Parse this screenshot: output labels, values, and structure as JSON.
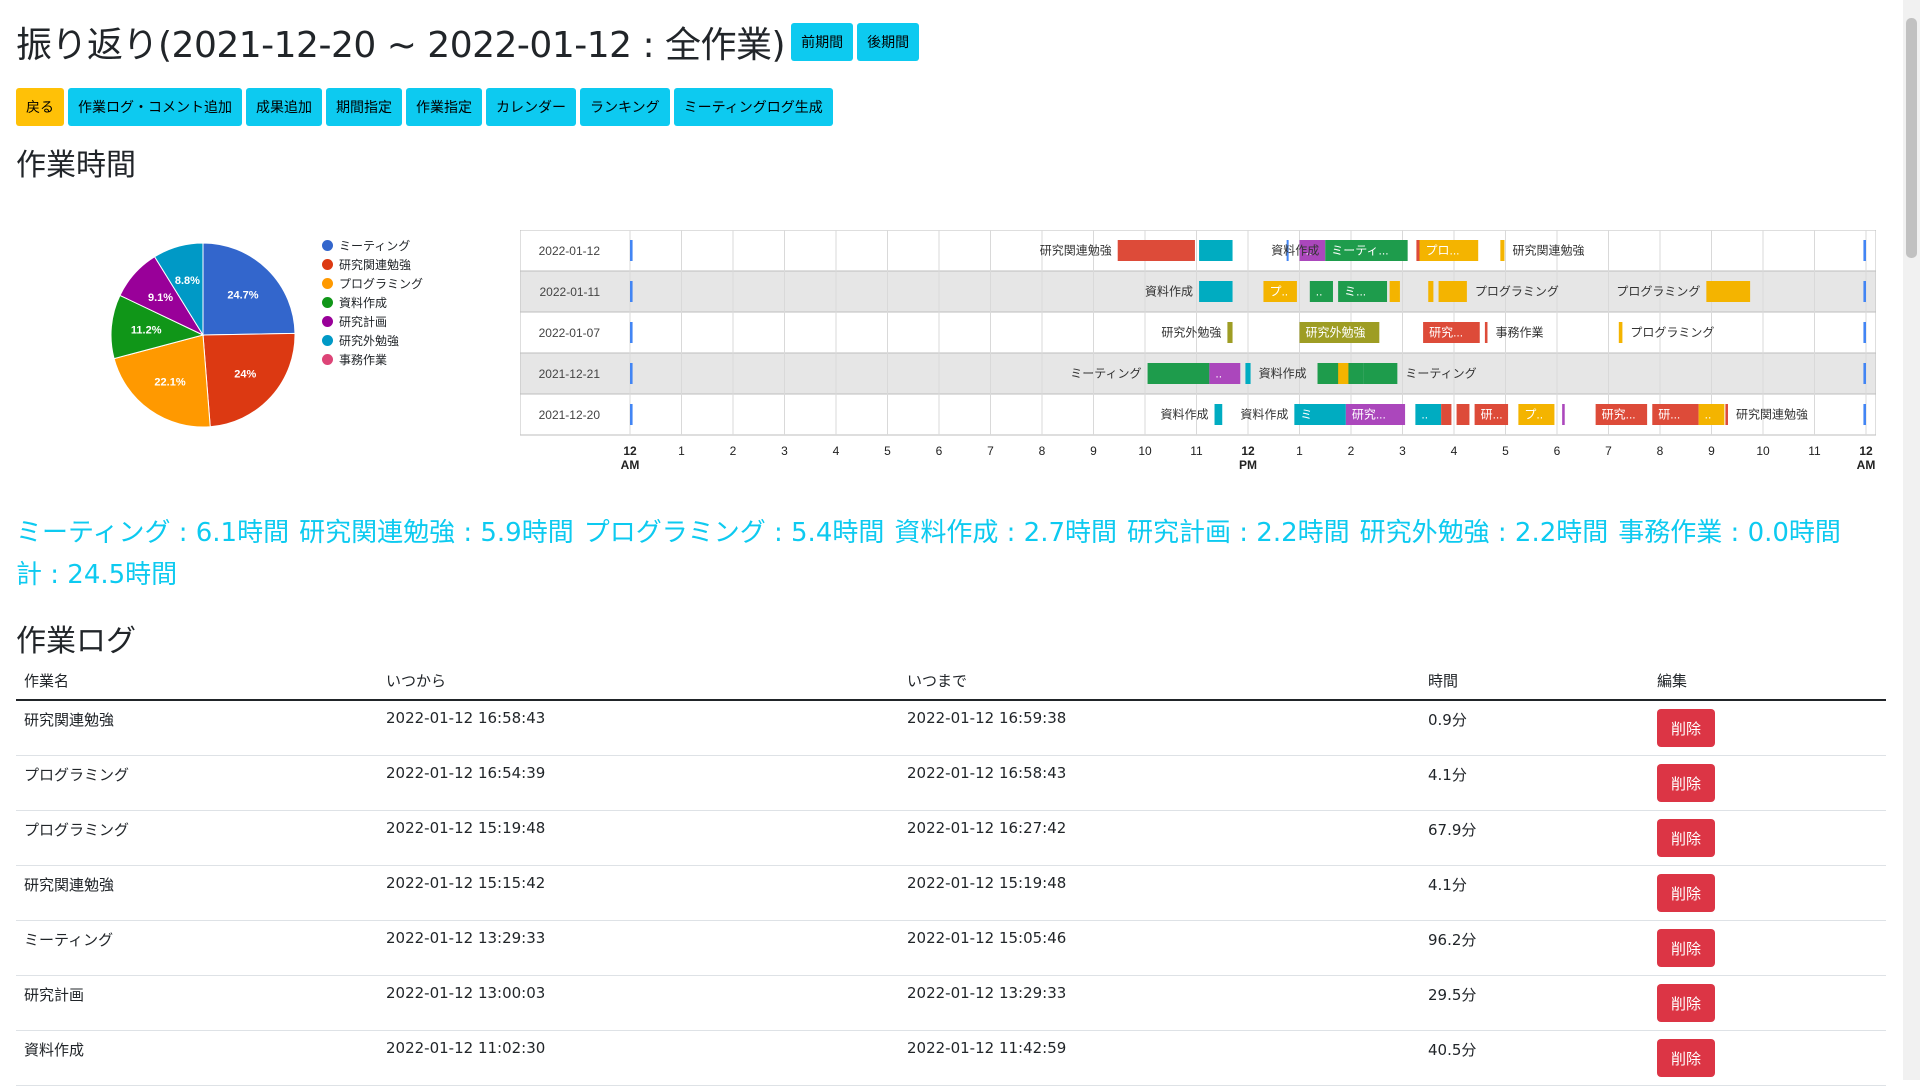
{
  "header": {
    "title": "振り返り(2021-12-20 ~ 2022-01-12 : 全作業)",
    "prev_label": "前期間",
    "next_label": "後期間"
  },
  "toolbar": [
    {
      "label": "戻る",
      "style": "warning"
    },
    {
      "label": "作業ログ・コメント追加",
      "style": "info"
    },
    {
      "label": "成果追加",
      "style": "info"
    },
    {
      "label": "期間指定",
      "style": "info"
    },
    {
      "label": "作業指定",
      "style": "info"
    },
    {
      "label": "カレンダー",
      "style": "info"
    },
    {
      "label": "ランキング",
      "style": "info"
    },
    {
      "label": "ミーティングログ生成",
      "style": "info"
    }
  ],
  "work_time": {
    "heading": "作業時間"
  },
  "colors": {
    "ミーティング": "#3366cc",
    "研究関連勉強": "#dc3912",
    "プログラミング": "#ff9900",
    "資料作成": "#109618",
    "研究計画": "#990099",
    "研究外勉強": "#0099c6",
    "事務作業": "#dd4477"
  },
  "chart_data": [
    {
      "type": "pie",
      "categories": [
        "ミーティング",
        "研究関連勉強",
        "プログラミング",
        "資料作成",
        "研究計画",
        "研究外勉強",
        "事務作業"
      ],
      "values": [
        24.7,
        24.0,
        22.1,
        11.2,
        9.1,
        8.8,
        0.0
      ],
      "labels": [
        "24.7%",
        "24%",
        "22.1%",
        "11.2%",
        "9.1%",
        "8.8%",
        ""
      ],
      "legend": "right"
    },
    {
      "type": "timeline",
      "rows": [
        "2022-01-12",
        "2022-01-11",
        "2022-01-07",
        "2021-12-21",
        "2021-12-20"
      ],
      "x_ticks": [
        "12 AM",
        "1",
        "2",
        "3",
        "4",
        "5",
        "6",
        "7",
        "8",
        "9",
        "10",
        "11",
        "12 PM",
        "1",
        "2",
        "3",
        "4",
        "5",
        "6",
        "7",
        "8",
        "9",
        "10",
        "11",
        "12 AM"
      ],
      "xlim_hours": [
        0,
        24
      ],
      "bar_colors": {
        "red": "#dd4b39",
        "teal": "#00acc1",
        "purple": "#ab47bc",
        "green": "#1e9c4c",
        "yellow": "#f4b400",
        "olive": "#9e9d24",
        "blue": "#4285f4"
      },
      "bars": [
        {
          "row": 0,
          "start": 0.0,
          "end": 0.05,
          "color": "blue",
          "label": ""
        },
        {
          "row": 0,
          "start": 12.75,
          "end": 12.77,
          "color": "blue",
          "label": ""
        },
        {
          "row": 0,
          "start": 9.47,
          "end": 10.97,
          "color": "red",
          "label": "研究関連勉強",
          "label_side": "left"
        },
        {
          "row": 0,
          "start": 11.05,
          "end": 11.7,
          "color": "teal",
          "label": ""
        },
        {
          "row": 0,
          "start": 13.0,
          "end": 13.5,
          "color": "purple",
          "label": "..",
          "label_side": "inside"
        },
        {
          "row": 0,
          "start": 13.5,
          "end": 15.1,
          "color": "green",
          "label": "ミーティ...",
          "label_side": "inside",
          "pre_label": "資料作成"
        },
        {
          "row": 0,
          "start": 15.27,
          "end": 15.33,
          "color": "red",
          "label": ""
        },
        {
          "row": 0,
          "start": 15.33,
          "end": 16.47,
          "color": "yellow",
          "label": "プロ...",
          "label_side": "inside"
        },
        {
          "row": 0,
          "start": 16.9,
          "end": 16.98,
          "color": "yellow",
          "label": "研究関連勉強",
          "label_side": "right"
        },
        {
          "row": 0,
          "start": 23.95,
          "end": 24.0,
          "color": "blue",
          "label": ""
        },
        {
          "row": 1,
          "start": 0.0,
          "end": 0.05,
          "color": "blue",
          "label": ""
        },
        {
          "row": 1,
          "start": 11.05,
          "end": 11.7,
          "color": "teal",
          "label": "資料作成",
          "label_side": "left"
        },
        {
          "row": 1,
          "start": 12.3,
          "end": 12.95,
          "color": "yellow",
          "label": "プ..",
          "label_side": "inside"
        },
        {
          "row": 1,
          "start": 13.2,
          "end": 13.65,
          "color": "green",
          "label": "..",
          "label_side": "inside"
        },
        {
          "row": 1,
          "start": 13.75,
          "end": 14.7,
          "color": "green",
          "label": "ミ...",
          "label_side": "inside"
        },
        {
          "row": 1,
          "start": 14.75,
          "end": 14.95,
          "color": "yellow",
          "label": ""
        },
        {
          "row": 1,
          "start": 15.5,
          "end": 15.6,
          "color": "yellow",
          "label": ""
        },
        {
          "row": 1,
          "start": 15.7,
          "end": 16.25,
          "color": "yellow",
          "label": "プログラミング",
          "label_side": "right"
        },
        {
          "row": 1,
          "start": 20.9,
          "end": 21.75,
          "color": "yellow",
          "label": "プログラミング",
          "label_side": "left"
        },
        {
          "row": 1,
          "start": 23.95,
          "end": 24.0,
          "color": "blue",
          "label": ""
        },
        {
          "row": 2,
          "start": 0.0,
          "end": 0.05,
          "color": "blue",
          "label": ""
        },
        {
          "row": 2,
          "start": 11.6,
          "end": 11.7,
          "color": "olive",
          "label": "研究外勉強",
          "label_side": "left"
        },
        {
          "row": 2,
          "start": 13.0,
          "end": 14.55,
          "color": "olive",
          "label": "研究外勉強",
          "label_side": "inside"
        },
        {
          "row": 2,
          "start": 15.4,
          "end": 16.5,
          "color": "red",
          "label": "研究...",
          "label_side": "inside"
        },
        {
          "row": 2,
          "start": 16.6,
          "end": 16.65,
          "color": "red",
          "label": "事務作業",
          "label_side": "right"
        },
        {
          "row": 2,
          "start": 19.2,
          "end": 19.27,
          "color": "yellow",
          "label": "プログラミング",
          "label_side": "right"
        },
        {
          "row": 2,
          "start": 23.95,
          "end": 24.0,
          "color": "blue",
          "label": ""
        },
        {
          "row": 3,
          "start": 0.0,
          "end": 0.05,
          "color": "blue",
          "label": ""
        },
        {
          "row": 3,
          "start": 10.05,
          "end": 11.25,
          "color": "green",
          "label": "ミーティング",
          "label_side": "left"
        },
        {
          "row": 3,
          "start": 11.25,
          "end": 11.85,
          "color": "purple",
          "label": "..",
          "label_side": "inside"
        },
        {
          "row": 3,
          "start": 11.95,
          "end": 12.05,
          "color": "teal",
          "label": "資料作成",
          "label_side": "right"
        },
        {
          "row": 3,
          "start": 13.35,
          "end": 14.25,
          "color": "green",
          "label": ""
        },
        {
          "row": 3,
          "start": 14.25,
          "end": 14.9,
          "color": "green",
          "label": "ミーティング",
          "label_side": "right"
        },
        {
          "row": 3,
          "start": 13.75,
          "end": 13.95,
          "color": "yellow",
          "label": ""
        },
        {
          "row": 3,
          "start": 23.95,
          "end": 24.0,
          "color": "blue",
          "label": ""
        },
        {
          "row": 4,
          "start": 0.0,
          "end": 0.05,
          "color": "blue",
          "label": ""
        },
        {
          "row": 4,
          "start": 11.35,
          "end": 11.5,
          "color": "teal",
          "label": "資料作成",
          "label_side": "left"
        },
        {
          "row": 4,
          "start": 12.9,
          "end": 13.9,
          "color": "teal",
          "label": "ミ",
          "label_side": "inside",
          "pre_label": "資料作成"
        },
        {
          "row": 4,
          "start": 13.9,
          "end": 15.05,
          "color": "purple",
          "label": "研究...",
          "label_side": "inside"
        },
        {
          "row": 4,
          "start": 15.25,
          "end": 15.75,
          "color": "teal",
          "label": "..",
          "label_side": "inside"
        },
        {
          "row": 4,
          "start": 15.75,
          "end": 15.95,
          "color": "red",
          "label": ""
        },
        {
          "row": 4,
          "start": 16.05,
          "end": 16.3,
          "color": "red",
          "label": ""
        },
        {
          "row": 4,
          "start": 16.4,
          "end": 17.05,
          "color": "red",
          "label": "研...",
          "label_side": "inside"
        },
        {
          "row": 4,
          "start": 17.25,
          "end": 17.95,
          "color": "yellow",
          "label": "プ..",
          "label_side": "inside"
        },
        {
          "row": 4,
          "start": 18.1,
          "end": 18.15,
          "color": "purple",
          "label": ""
        },
        {
          "row": 4,
          "start": 18.75,
          "end": 19.75,
          "color": "red",
          "label": "研究...",
          "label_side": "inside"
        },
        {
          "row": 4,
          "start": 19.85,
          "end": 20.75,
          "color": "red",
          "label": "研...",
          "label_side": "inside"
        },
        {
          "row": 4,
          "start": 20.75,
          "end": 21.25,
          "color": "yellow",
          "label": "..",
          "label_side": "inside"
        },
        {
          "row": 4,
          "start": 21.27,
          "end": 21.32,
          "color": "red",
          "label": "研究関連勉強",
          "label_side": "right"
        },
        {
          "row": 4,
          "start": 23.95,
          "end": 24.0,
          "color": "blue",
          "label": ""
        }
      ]
    }
  ],
  "summary": {
    "items": [
      "ミーティング : 6.1時間",
      "研究関連勉強 : 5.9時間",
      "プログラミング : 5.4時間",
      "資料作成 : 2.7時間",
      "研究計画 : 2.2時間",
      "研究外勉強 : 2.2時間",
      "事務作業 : 0.0時間"
    ],
    "total": "計 : 24.5時間"
  },
  "log": {
    "heading": "作業ログ",
    "columns": [
      "作業名",
      "いつから",
      "いつまで",
      "時間",
      "編集"
    ],
    "delete_label": "削除",
    "rows": [
      {
        "name": "研究関連勉強",
        "from": "2022-01-12 16:58:43",
        "to": "2022-01-12 16:59:38",
        "time": "0.9分"
      },
      {
        "name": "プログラミング",
        "from": "2022-01-12 16:54:39",
        "to": "2022-01-12 16:58:43",
        "time": "4.1分"
      },
      {
        "name": "プログラミング",
        "from": "2022-01-12 15:19:48",
        "to": "2022-01-12 16:27:42",
        "time": "67.9分"
      },
      {
        "name": "研究関連勉強",
        "from": "2022-01-12 15:15:42",
        "to": "2022-01-12 15:19:48",
        "time": "4.1分"
      },
      {
        "name": "ミーティング",
        "from": "2022-01-12 13:29:33",
        "to": "2022-01-12 15:05:46",
        "time": "96.2分"
      },
      {
        "name": "研究計画",
        "from": "2022-01-12 13:00:03",
        "to": "2022-01-12 13:29:33",
        "time": "29.5分"
      },
      {
        "name": "資料作成",
        "from": "2022-01-12 11:02:30",
        "to": "2022-01-12 11:42:59",
        "time": "40.5分"
      }
    ]
  }
}
